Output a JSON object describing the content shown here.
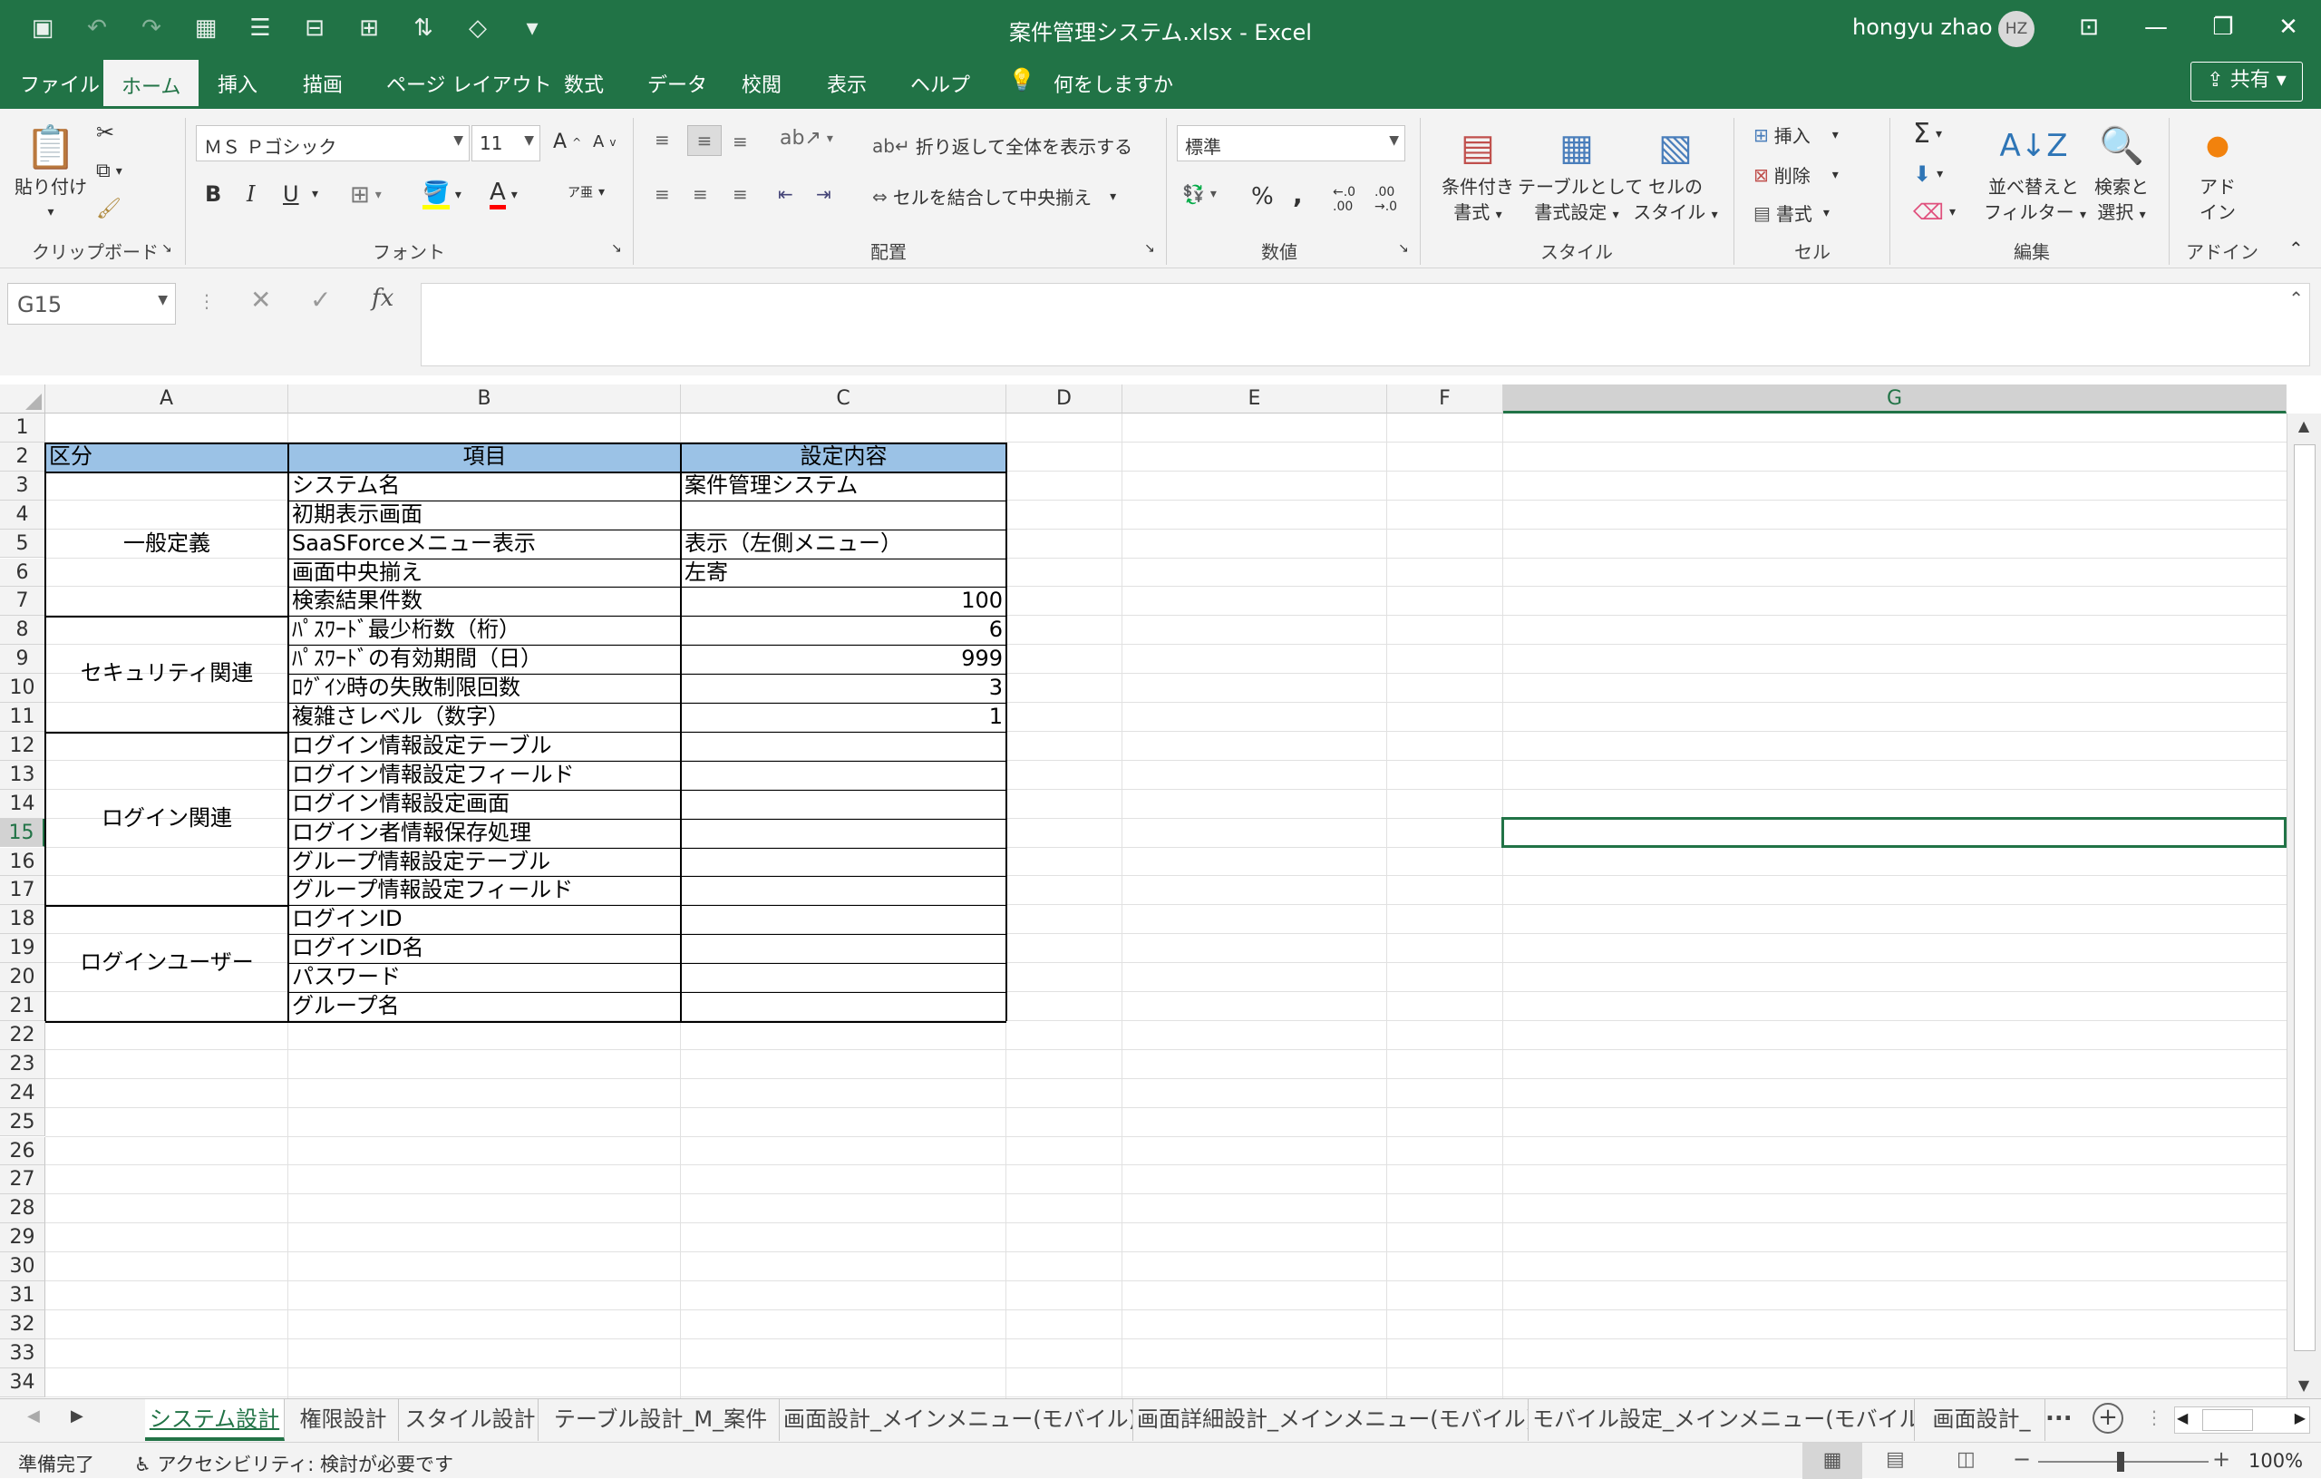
{
  "window": {
    "title": "案件管理システム.xlsx  -  Excel",
    "user_name": "hongyu zhao",
    "user_initials": "HZ"
  },
  "menu": {
    "tabs": [
      "ファイル",
      "ホーム",
      "挿入",
      "描画",
      "ページ レイアウト",
      "数式",
      "データ",
      "校閲",
      "表示",
      "ヘルプ"
    ],
    "active_tab": "ホーム",
    "tell_me": "何をしますか",
    "share": "共有"
  },
  "ribbon": {
    "clipboard": {
      "paste": "貼り付け",
      "label": "クリップボード"
    },
    "font": {
      "name": "ＭＳ Ｐゴシック",
      "size": "11",
      "bold": "B",
      "italic": "I",
      "underline": "U",
      "grow": "A",
      "shrink": "A",
      "color_a": "A",
      "phonetic": "ア亜",
      "label": "フォント"
    },
    "alignment": {
      "wrap": "折り返して全体を表示する",
      "merge": "セルを結合して中央揃え",
      "label": "配置"
    },
    "number": {
      "format": "標準",
      "percent": "%",
      "comma": ",",
      "inc": "←.0 .00",
      "dec": ".00 →.0",
      "label": "数値"
    },
    "styles": {
      "conditional": [
        "条件付き",
        "書式"
      ],
      "table": [
        "テーブルとして",
        "書式設定"
      ],
      "cell": [
        "セルの",
        "スタイル"
      ],
      "label": "スタイル"
    },
    "cells": {
      "insert": "挿入",
      "delete": "削除",
      "format": "書式",
      "label": "セル"
    },
    "editing": {
      "autosum": "Σ",
      "sort": [
        "並べ替えと",
        "フィルター"
      ],
      "find": [
        "検索と",
        "選択"
      ],
      "label": "編集"
    },
    "addins": {
      "addin": [
        "アド",
        "イン"
      ],
      "label": "アドイン"
    },
    "colors": {
      "accent": "#217346",
      "header_fill": "#9BC2E6",
      "fill_yellow": "#FFFF00",
      "font_red": "#FF0000"
    }
  },
  "formula_bar": {
    "name_box": "G15",
    "fx": "fx",
    "content": ""
  },
  "sheet": {
    "columns": [
      "A",
      "B",
      "C",
      "D",
      "E",
      "F",
      "G"
    ],
    "selected_column": "G",
    "selected_row": "15",
    "active_cell": "G15",
    "row_numbers": [
      "1",
      "2",
      "3",
      "4",
      "5",
      "6",
      "7",
      "8",
      "9",
      "10",
      "11",
      "12",
      "13",
      "14",
      "15",
      "16",
      "17",
      "18",
      "19",
      "20",
      "21",
      "22",
      "23",
      "24",
      "25",
      "26",
      "27",
      "28",
      "29",
      "30",
      "31",
      "32",
      "33",
      "34"
    ],
    "header": {
      "kubun": "区分",
      "koumoku": "項目",
      "settei": "設定内容"
    },
    "groups": [
      "一般定義",
      "セキュリティ関連",
      "ログイン関連",
      "ログインユーザー"
    ],
    "rows": [
      {
        "item": "システム名",
        "value": "案件管理システム"
      },
      {
        "item": "初期表示画面",
        "value": ""
      },
      {
        "item": "SaaSForceメニュー表示",
        "value": "表示（左側メニュー）"
      },
      {
        "item": "画面中央揃え",
        "value": "左寄"
      },
      {
        "item": "検索結果件数",
        "value": "100"
      },
      {
        "item": "ﾊﾟｽﾜｰﾄﾞ最少桁数（桁）",
        "value": "6"
      },
      {
        "item": "ﾊﾟｽﾜｰﾄﾞの有効期間（日）",
        "value": "999"
      },
      {
        "item": "ﾛｸﾞｲﾝ時の失敗制限回数",
        "value": "3"
      },
      {
        "item": "複雑さレベル（数字）",
        "value": "1"
      },
      {
        "item": "ログイン情報設定テーブル",
        "value": ""
      },
      {
        "item": "ログイン情報設定フィールド",
        "value": ""
      },
      {
        "item": "ログイン情報設定画面",
        "value": ""
      },
      {
        "item": "ログイン者情報保存処理",
        "value": ""
      },
      {
        "item": "グループ情報設定テーブル",
        "value": ""
      },
      {
        "item": "グループ情報設定フィールド",
        "value": ""
      },
      {
        "item": "ログインID",
        "value": ""
      },
      {
        "item": "ログインID名",
        "value": ""
      },
      {
        "item": "パスワード",
        "value": ""
      },
      {
        "item": "グループ名",
        "value": ""
      }
    ]
  },
  "sheet_tabs": [
    "システム設計",
    "権限設計",
    "スタイル設計",
    "テーブル設計_M_案件",
    "画面設計_メインメニュー(モバイル)",
    "画面詳細設計_メインメニュー(モバイル)",
    "モバイル設定_メインメニュー(モバイル)",
    "画面設計_"
  ],
  "sheet_tabs_more": "...",
  "active_sheet": "システム設計",
  "status": {
    "ready": "準備完了",
    "accessibility": "アクセシビリティ: 検討が必要です",
    "zoom": "100%"
  }
}
